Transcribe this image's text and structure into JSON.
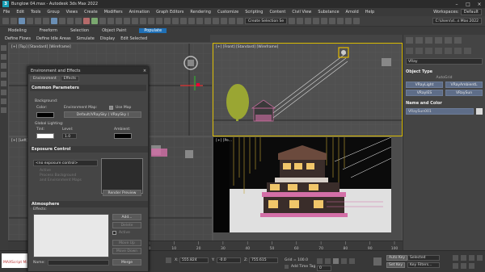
{
  "window": {
    "title": "Bunglow 04.max - Autodesk 3ds Max 2022"
  },
  "menu": {
    "items": [
      "File",
      "Edit",
      "Tools",
      "Group",
      "Views",
      "Create",
      "Modifiers",
      "Animation",
      "Graph Editors",
      "Rendering",
      "Customize",
      "Scripting",
      "Content",
      "Civil View",
      "Substance",
      "Arnold",
      "Help"
    ],
    "workspaces_label": "Workspaces:",
    "workspaces_value": "Default"
  },
  "toolbar": {
    "create_selection_set": "Create Selection Se",
    "path_dropdown": "C:\\Users\\d...s Max 2022"
  },
  "ribbon": {
    "tabs": [
      "Modeling",
      "Freeform",
      "Selection",
      "Object Paint"
    ],
    "populate": "Populate",
    "subtabs": [
      "Define Flows",
      "Define Idle Areas",
      "Simulate",
      "Display",
      "Edit Selected"
    ]
  },
  "viewports": {
    "top": "[+] [Top] [Standard] [Wireframe]",
    "front": "[+] [Front] [Standard] [Wireframe]",
    "left": "[+] [Left]",
    "perspective": "[+] [Pe..."
  },
  "command_panel": {
    "dropdown": "VRay",
    "object_type": "Object Type",
    "autogrid": "AutoGrid",
    "buttons": [
      [
        "VRayLight",
        "VRayAmbientL"
      ],
      [
        "VRayIES",
        "VRaySun"
      ]
    ],
    "name_and_color": "Name and Color",
    "object_name": "VRaySun001"
  },
  "env_dialog": {
    "title": "Environment and Effects",
    "tabs": [
      "Environment",
      "Effects"
    ],
    "common_params": "Common Parameters",
    "background": "Background:",
    "color": "Color:",
    "env_map": "Environment Map:",
    "use_map": "Use Map",
    "map_name": "Default/VRaySky  ( VRaySky )",
    "global_lighting": "Global Lighting:",
    "tint": "Tint:",
    "level": "Level:",
    "level_value": "1.0",
    "ambient": "Ambient:",
    "exposure_control": "Exposure Control",
    "exposure_dropdown": "<no exposure control>",
    "active": "Active",
    "process_bg": "Process Background",
    "and_env_maps": "and Environment Maps",
    "render_preview": "Render Preview",
    "atmosphere": "Atmosphere",
    "effects": "Effects:",
    "add": "Add...",
    "delete": "Delete",
    "active2": "Active",
    "move_up": "Move Up",
    "move_down": "Move Down",
    "merge": "Merge",
    "name": "Name:"
  },
  "timeline": {
    "ticks": [
      "0",
      "10",
      "20",
      "30",
      "40",
      "50",
      "60",
      "70",
      "80",
      "90",
      "100"
    ]
  },
  "status": {
    "x_label": "X:",
    "x_value": "555.824",
    "y_label": "Y:",
    "y_value": "-0.0",
    "z_label": "Z:",
    "z_value": "755.615",
    "grid": "Grid = 100.0",
    "add_time_tag": "Add Time Tag",
    "auto_key": "Auto Key",
    "selected": "Selected",
    "set_key": "Set Key",
    "key_filters": "Key Filters...",
    "frame": "0",
    "maxscript": "MAXScript Mi"
  }
}
